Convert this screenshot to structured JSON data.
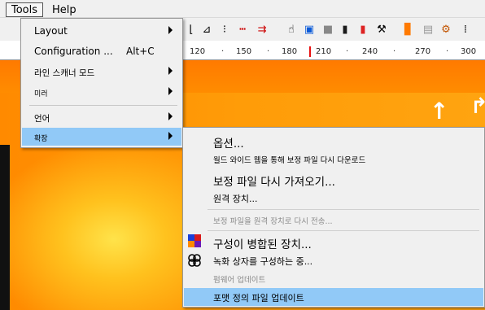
{
  "menubar": {
    "tools_label": "Tools",
    "help_label": "Help"
  },
  "ruler": {
    "ticks": [
      "120",
      "150",
      "180",
      "210",
      "240",
      "270",
      "300"
    ]
  },
  "tools_menu": {
    "items": [
      {
        "label": "Layout",
        "has_submenu": true
      },
      {
        "label": "Configuration ...",
        "shortcut": "Alt+C",
        "has_submenu": false
      },
      {
        "label": "라인 스캐너 모드",
        "has_submenu": true
      },
      {
        "label": "미러",
        "has_submenu": true
      },
      {
        "label": "언어",
        "has_submenu": true
      },
      {
        "label": "확장",
        "has_submenu": true,
        "highlighted": true
      }
    ]
  },
  "extension_menu": {
    "items": [
      {
        "label": "옵션...",
        "enabled": true
      },
      {
        "label": "월드 와이드 웹을 통해 보정 파일 다시 다운로드",
        "enabled": true
      },
      {
        "label": "보정 파일 다시 가져오기...",
        "enabled": true
      },
      {
        "label": "원격 장치...",
        "enabled": true
      },
      {
        "label": "보정 파일을 원격 장치로 다시 전송...",
        "enabled": false
      },
      {
        "label": "구성이 병합된 장치...",
        "enabled": true,
        "icon": "merged-device-icon"
      },
      {
        "label": "녹화 상자를 구성하는 중...",
        "enabled": true,
        "icon": "recording-box-icon"
      },
      {
        "label": "펌웨어 업데이트",
        "enabled": false
      },
      {
        "label": "포맷 정의 파일 업데이트",
        "enabled": true,
        "highlighted": true
      }
    ]
  },
  "colors": {
    "menu_background": "#f0f0f0",
    "highlight": "#91c9f7",
    "thermal_orange": "#ff9c08",
    "thermal_yellow": "#ffe34a",
    "ruler_marker": "#e81010"
  }
}
